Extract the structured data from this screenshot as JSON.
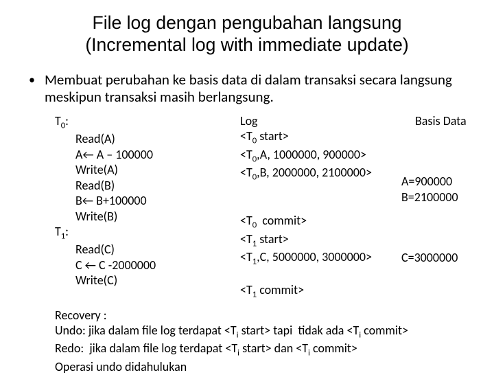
{
  "title_line1": "File log dengan pengubahan langsung",
  "title_line2": "(Incremental log with immediate update)",
  "bullet": "Membuat perubahan ke basis data di dalam transaksi secara langsung meskipun transaksi masih berlangsung.",
  "left": {
    "t0_label": "T",
    "t0_sub": "0",
    "t0_colon": ":",
    "t0_ops": [
      "Read(A)",
      "A← A – 100000",
      "Write(A)",
      "Read(B)",
      "B← B+100000",
      "Write(B)"
    ],
    "t1_label": "T",
    "t1_sub": "1",
    "t1_colon": ":",
    "t1_ops": [
      "Read(C)",
      "C ← C -2000000",
      "Write(C)"
    ]
  },
  "mid": {
    "log_title": "Log",
    "lines_top": [
      "<T0 start>",
      "<T0,A, 1000000, 900000>",
      "<T0,B, 2000000, 2100000>"
    ],
    "lines_mid": [
      "<T0  commit>",
      "<T1 start>",
      "<T1,C, 5000000, 3000000>"
    ],
    "lines_bot": [
      "<T1 commit>"
    ]
  },
  "right": {
    "basis_title": "Basis Data",
    "valA": "A=900000",
    "valB": "B=2100000",
    "valC": "C=3000000"
  },
  "recovery": {
    "r0": "Recovery :",
    "r1": "Undo: jika dalam file log terdapat <Ti start> tapi  tidak ada <Ti commit>",
    "r2": "Redo:  jika dalam file log terdapat <Ti start> dan <Ti commit>",
    "r3": "Operasi undo didahulukan"
  }
}
